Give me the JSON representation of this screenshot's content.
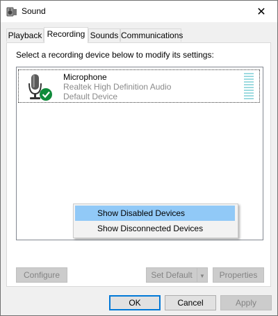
{
  "window": {
    "title": "Sound"
  },
  "tabs": [
    {
      "label": "Playback"
    },
    {
      "label": "Recording"
    },
    {
      "label": "Sounds"
    },
    {
      "label": "Communications"
    }
  ],
  "instruction": "Select a recording device below to modify its settings:",
  "device": {
    "name": "Microphone",
    "driver": "Realtek High Definition Audio",
    "status": "Default Device",
    "level": 0
  },
  "context_menu": {
    "items": [
      {
        "label": "Show Disabled Devices"
      },
      {
        "label": "Show Disconnected Devices"
      }
    ]
  },
  "buttons": {
    "configure": "Configure",
    "set_default": "Set Default",
    "properties": "Properties",
    "ok": "OK",
    "cancel": "Cancel",
    "apply": "Apply"
  },
  "colors": {
    "highlight": "#91c9f7",
    "check": "#0f8a3a",
    "accent": "#0078d7"
  }
}
